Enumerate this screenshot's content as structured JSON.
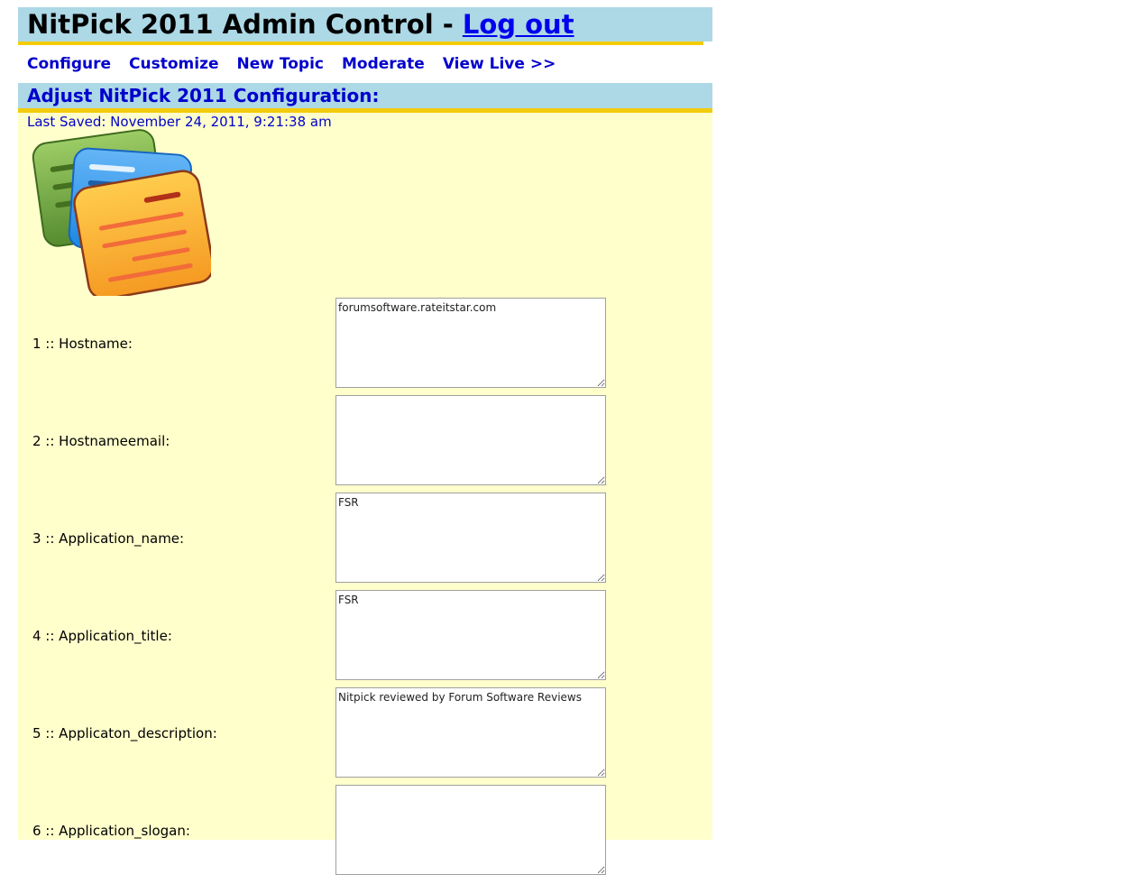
{
  "header": {
    "title": "NitPick 2011 Admin Control - ",
    "logout_label": "Log out"
  },
  "nav": {
    "items": [
      {
        "label": "Configure"
      },
      {
        "label": "Customize"
      },
      {
        "label": "New Topic"
      },
      {
        "label": "Moderate"
      },
      {
        "label": "View Live >>"
      }
    ]
  },
  "section": {
    "title": "Adjust NitPick 2011 Configuration:",
    "last_saved": "Last Saved: November 24, 2011, 9:21:38 am"
  },
  "logo": {
    "icon": "stacked-notes-icon",
    "colors": [
      "#7cb342",
      "#4a9fe0",
      "#ffb74d"
    ]
  },
  "fields": [
    {
      "label": "1 :: Hostname:",
      "value": "forumsoftware.rateitstar.com"
    },
    {
      "label": "2 :: Hostnameemail:",
      "value": ""
    },
    {
      "label": "3 :: Application_name:",
      "value": "FSR"
    },
    {
      "label": "4 :: Application_title:",
      "value": "FSR"
    },
    {
      "label": "5 :: Applicaton_description:",
      "value": "Nitpick reviewed by Forum Software Reviews"
    },
    {
      "label": "6 :: Application_slogan:",
      "value": ""
    }
  ],
  "colors": {
    "header_bg": "#add8e6",
    "accent_yellow": "#f2cc0c",
    "content_bg": "#ffffcc",
    "link_blue": "#0000cc"
  }
}
